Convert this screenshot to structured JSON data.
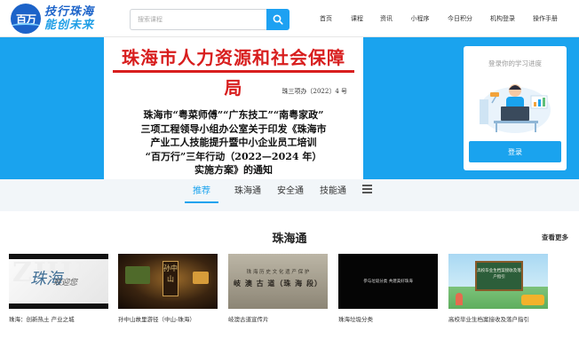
{
  "header": {
    "logo_mark": "百万",
    "logo_line1": "技行珠海",
    "logo_line2": "能创未来",
    "search_placeholder": "搜索课程",
    "nav": [
      "首页",
      "课程",
      "资讯",
      "小程序",
      "今日积分",
      "机构登录",
      "操作手册"
    ]
  },
  "hero": {
    "notice_org": "珠海市人力资源和社会保障局",
    "notice_number": "珠三项办〔2022〕4 号",
    "notice_title_lines": [
      "珠海市“粤菜师傅”“广东技工”“南粤家政”",
      "三项工程领导小组办公室关于印发《珠海市",
      "产业工人技能提升暨中小企业员工培训",
      "“百万行”三年行动（2022—2024 年）",
      "实施方案》的通知"
    ]
  },
  "login": {
    "hint": "登录你的学习进度",
    "button": "登录"
  },
  "tabs": [
    "推荐",
    "珠海通",
    "安全通",
    "技能通"
  ],
  "section": {
    "title": "珠海通",
    "more": "查看更多",
    "cards": [
      {
        "caption": "珠海：创新热土 产业之城",
        "thumb_text_1": "珠海",
        "thumb_text_2": "欢迎您"
      },
      {
        "caption": "孙中山故里游径（中山-珠海）",
        "thumb_text_1": "孙中山"
      },
      {
        "caption": "岐澳古道宣传片",
        "thumb_text_1": "珠 海 历 史 文 化 遗 产 保 护",
        "thumb_text_2": "岐 澳 古 道（珠 海 段）"
      },
      {
        "caption": "珠海垃圾分类",
        "thumb_text_1": "参与垃圾分类   共建美好珠海"
      },
      {
        "caption": "高校毕业生档案接收及落户指引",
        "thumb_text_1": "高校毕业生档案接收及落户指引"
      }
    ]
  }
}
